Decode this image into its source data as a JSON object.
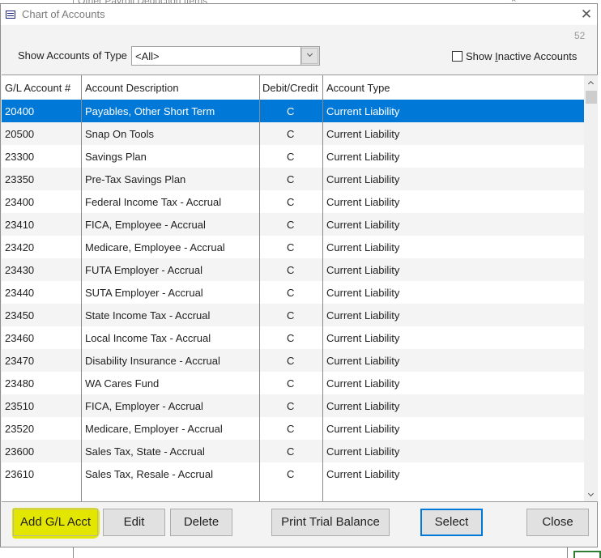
{
  "background_window": {
    "title": "Other Payroll Deduction Items"
  },
  "window": {
    "title": "Chart of Accounts",
    "icon": "app-window-icon",
    "close_icon": "close-icon"
  },
  "record_count": "52",
  "filter": {
    "label": "Show Accounts of Type",
    "selected": "<All>"
  },
  "show_inactive": {
    "label": "Show Inactive Accounts",
    "checked": false
  },
  "table": {
    "columns": [
      "G/L Account #",
      "Account Description",
      "Debit/Credit",
      "Account Type"
    ],
    "selected_index": 0,
    "rows": [
      {
        "account": "20400",
        "description": "Payables, Other Short Term",
        "dc": "C",
        "type": "Current Liability"
      },
      {
        "account": "20500",
        "description": "Snap On Tools",
        "dc": "C",
        "type": "Current Liability"
      },
      {
        "account": "23300",
        "description": "Savings Plan",
        "dc": "C",
        "type": "Current Liability"
      },
      {
        "account": "23350",
        "description": "Pre-Tax Savings Plan",
        "dc": "C",
        "type": "Current Liability"
      },
      {
        "account": "23400",
        "description": "Federal Income Tax - Accrual",
        "dc": "C",
        "type": "Current Liability"
      },
      {
        "account": "23410",
        "description": "FICA, Employee - Accrual",
        "dc": "C",
        "type": "Current Liability"
      },
      {
        "account": "23420",
        "description": "Medicare, Employee - Accrual",
        "dc": "C",
        "type": "Current Liability"
      },
      {
        "account": "23430",
        "description": "FUTA Employer - Accrual",
        "dc": "C",
        "type": "Current Liability"
      },
      {
        "account": "23440",
        "description": "SUTA Employer - Accrual",
        "dc": "C",
        "type": "Current Liability"
      },
      {
        "account": "23450",
        "description": "State Income Tax - Accrual",
        "dc": "C",
        "type": "Current Liability"
      },
      {
        "account": "23460",
        "description": "Local Income Tax - Accrual",
        "dc": "C",
        "type": "Current Liability"
      },
      {
        "account": "23470",
        "description": "Disability Insurance - Accrual",
        "dc": "C",
        "type": "Current Liability"
      },
      {
        "account": "23480",
        "description": "WA Cares Fund",
        "dc": "C",
        "type": "Current Liability"
      },
      {
        "account": "23510",
        "description": "FICA, Employer - Accrual",
        "dc": "C",
        "type": "Current Liability"
      },
      {
        "account": "23520",
        "description": "Medicare, Employer - Accrual",
        "dc": "C",
        "type": "Current Liability"
      },
      {
        "account": "23600",
        "description": "Sales Tax, State - Accrual",
        "dc": "C",
        "type": "Current Liability"
      },
      {
        "account": "23610",
        "description": "Sales Tax, Resale - Accrual",
        "dc": "C",
        "type": "Current Liability"
      }
    ]
  },
  "buttons": {
    "add": "Add G/L Acct",
    "edit": "Edit",
    "delete": "Delete",
    "print": "Print Trial Balance",
    "select": "Select",
    "close": "Close"
  },
  "colors": {
    "selection": "#0078d7",
    "highlight": "#e3e600",
    "focus_border": "#0078d7"
  }
}
